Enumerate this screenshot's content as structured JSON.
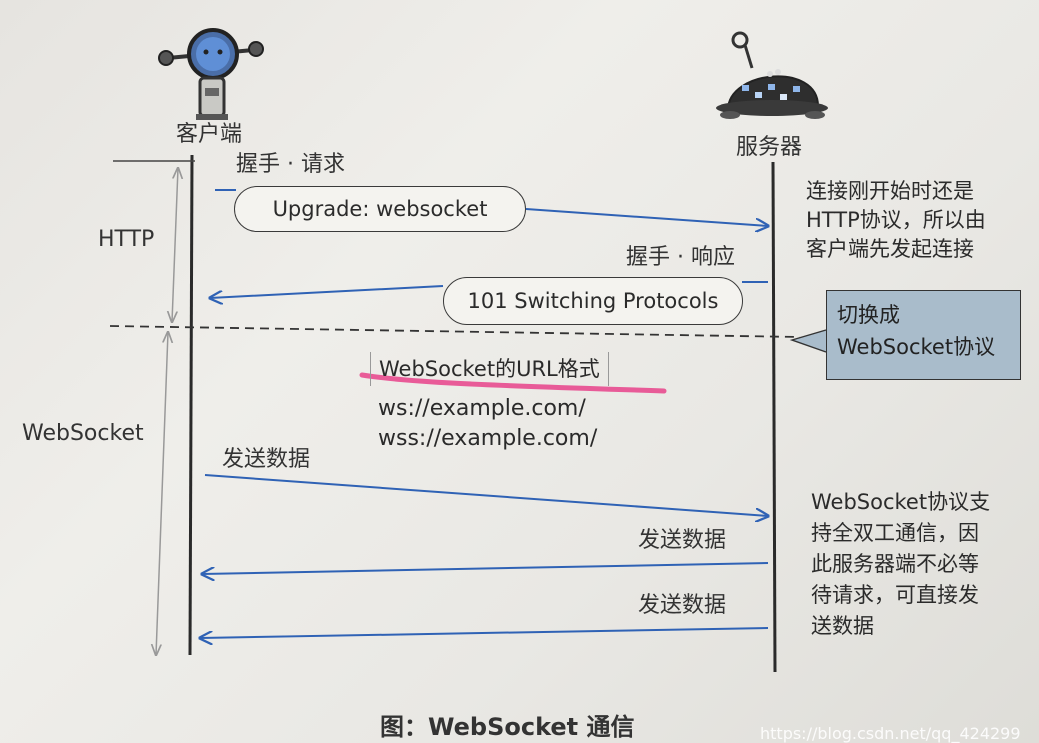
{
  "actors": {
    "client": "客户端",
    "server": "服务器"
  },
  "phases": {
    "http": "HTTP",
    "websocket": "WebSocket"
  },
  "handshake": {
    "request_label": "握手 · 请求",
    "request_pill": "Upgrade: websocket",
    "response_label": "握手 · 响应",
    "response_pill": "101 Switching Protocols"
  },
  "notes": {
    "http_note": [
      "连接刚开始时还是",
      "HTTP协议，所以由",
      "客户端先发起连接"
    ],
    "switch_note": [
      "切换成",
      "WebSocket协议"
    ],
    "duplex_note": [
      "WebSocket协议支",
      "持全双工通信，因",
      "此服务器端不必等",
      "待请求，可直接发",
      "送数据"
    ]
  },
  "url_format": {
    "title": "WebSocket的URL格式",
    "lines": [
      "ws://example.com/",
      "wss://example.com/"
    ]
  },
  "messages": {
    "client_send": "发送数据",
    "server_send_1": "发送数据",
    "server_send_2": "发送数据"
  },
  "caption": "图：WebSocket 通信",
  "watermark": "https://blog.csdn.net/qq_424299",
  "colors": {
    "arrow": "#2f62b5",
    "highlight": "#e8428a",
    "callout_fill": "#a9bccb"
  },
  "icons": {
    "client": "robot-icon",
    "server": "server-robot-icon"
  }
}
